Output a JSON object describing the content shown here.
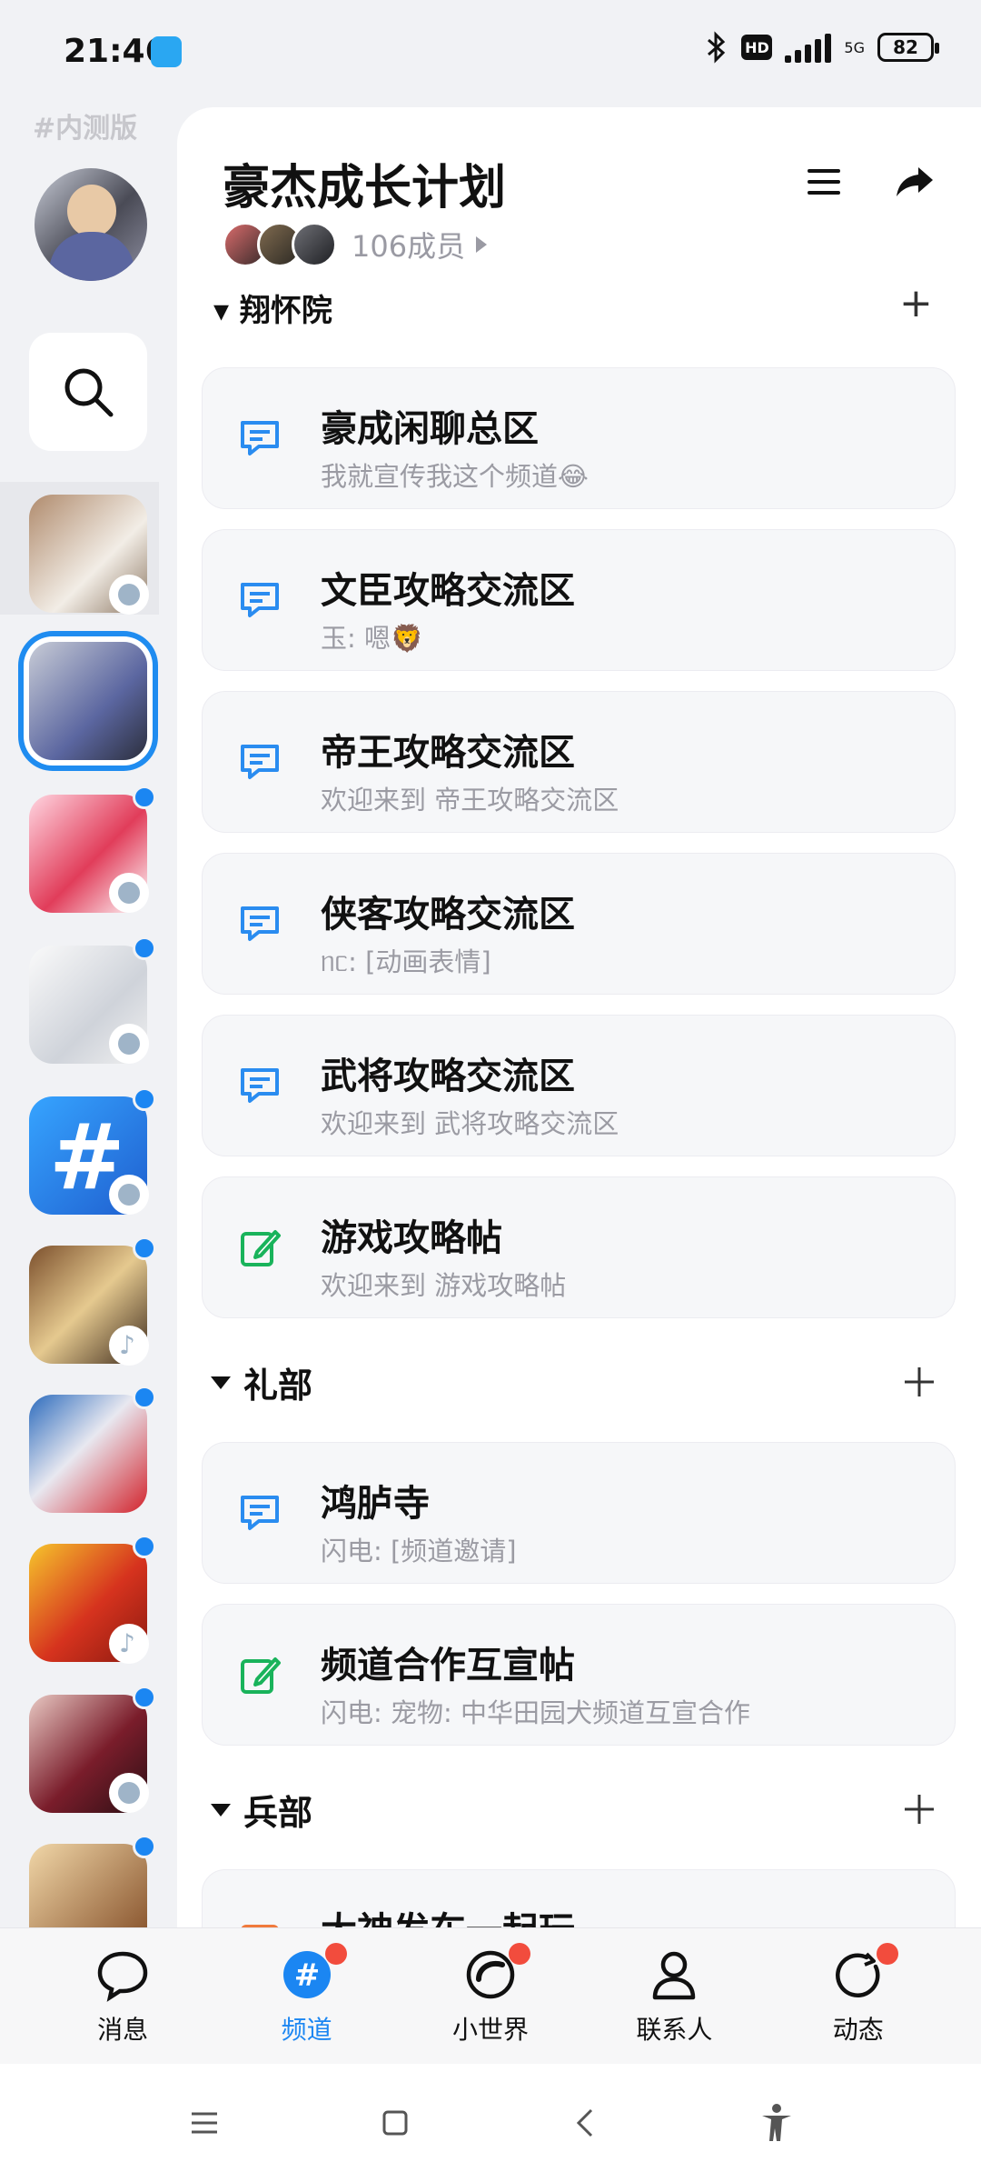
{
  "status_bar": {
    "time": "21:46",
    "network": "5G",
    "hd": "HD",
    "battery": "82"
  },
  "left_rail": {
    "beta_tag": "#内测版"
  },
  "channel": {
    "title": "豪杰成长计划",
    "member_count": "106成员",
    "partial_section": "翔怀院",
    "cards_group1": [
      {
        "name": "豪成闲聊总区",
        "sub": "我就宣传我这个频道😂",
        "icon": "chat-icon"
      },
      {
        "name": "文臣攻略交流区",
        "sub": "玉: 嗯🦁",
        "icon": "chat-icon"
      },
      {
        "name": "帝王攻略交流区",
        "sub": "欢迎来到 帝王攻略交流区",
        "icon": "chat-icon"
      },
      {
        "name": "侠客攻略交流区",
        "sub": "ᥒᥴ: [动画表情]",
        "icon": "chat-icon"
      },
      {
        "name": "武将攻略交流区",
        "sub": "欢迎来到 武将攻略交流区",
        "icon": "chat-icon"
      },
      {
        "name": "游戏攻略帖",
        "sub": "欢迎来到 游戏攻略帖",
        "icon": "post-icon"
      }
    ],
    "section_libu": "礼部",
    "cards_group2": [
      {
        "name": "鸿胪寺",
        "sub": "闪电: [频道邀请]",
        "icon": "chat-icon"
      },
      {
        "name": "频道合作互宣帖",
        "sub": "闪电: 宠物: 中华田园犬频道互宣合作",
        "icon": "post-icon"
      }
    ],
    "section_bingbu": "兵部",
    "partial_card": "大神发车一起玩"
  },
  "tabs": [
    {
      "label": "消息",
      "icon": "message-icon",
      "active": false,
      "badge": false
    },
    {
      "label": "频道",
      "icon": "channel-icon",
      "active": true,
      "badge": true
    },
    {
      "label": "小世界",
      "icon": "world-icon",
      "active": false,
      "badge": true
    },
    {
      "label": "联系人",
      "icon": "contacts-icon",
      "active": false,
      "badge": false
    },
    {
      "label": "动态",
      "icon": "feed-icon",
      "active": false,
      "badge": true
    }
  ],
  "colors": {
    "accent": "#1b86f2",
    "chat_icon": "#2a8cf0",
    "post_icon": "#19b35b",
    "badge": "#f24c3d"
  }
}
